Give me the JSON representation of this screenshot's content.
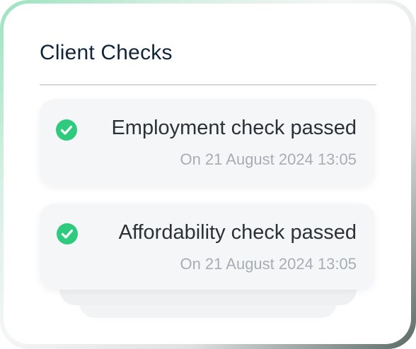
{
  "panel": {
    "title": "Client Checks"
  },
  "checks": [
    {
      "label": "Employment check passed",
      "date": "On 21 August 2024 13:05",
      "status": "passed",
      "icon": "check-circle-icon"
    },
    {
      "label": "Affordability check passed",
      "date": "On 21 August 2024 13:05",
      "status": "passed",
      "icon": "check-circle-icon"
    }
  ],
  "colors": {
    "success": "#2ecb7f",
    "title": "#10243a",
    "label": "#2c3138",
    "muted": "#a8adb5"
  }
}
